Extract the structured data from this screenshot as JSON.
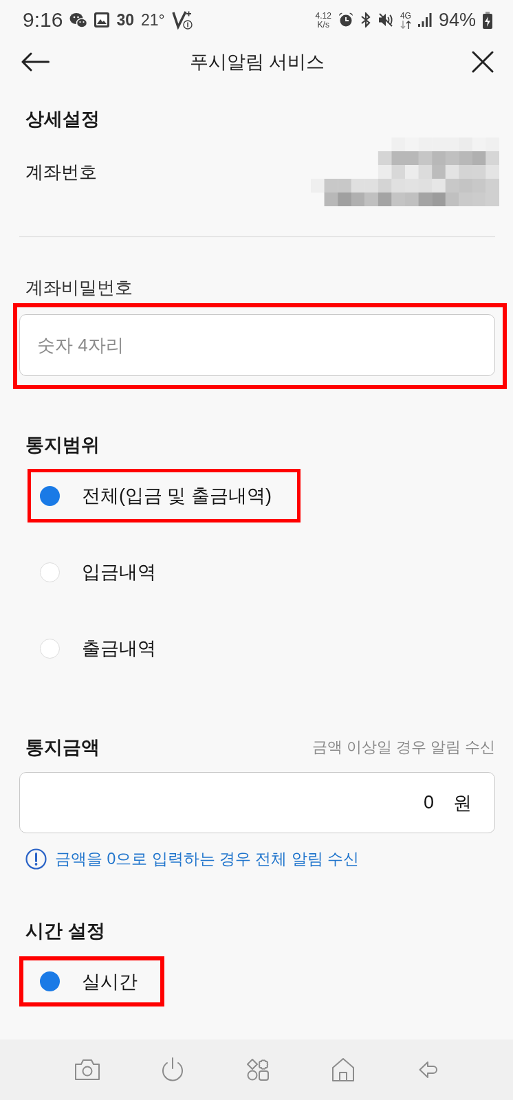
{
  "status_bar": {
    "time": "9:16",
    "notification_count": "30",
    "temperature": "21°",
    "net_speed": {
      "value": "4.12",
      "unit": "K/s"
    },
    "network": "4G",
    "battery": "94%"
  },
  "header": {
    "title": "푸시알림 서비스"
  },
  "detail": {
    "heading": "상세설정",
    "account_label": "계좌번호"
  },
  "password": {
    "label": "계좌비밀번호",
    "placeholder": "숫자 4자리",
    "highlighted": true
  },
  "notify_scope": {
    "heading": "통지범위",
    "options": [
      {
        "label": "전체(입금 및 출금내역)",
        "selected": true,
        "highlighted": true
      },
      {
        "label": "입금내역",
        "selected": false,
        "highlighted": false
      },
      {
        "label": "출금내역",
        "selected": false,
        "highlighted": false
      }
    ]
  },
  "notify_amount": {
    "heading": "통지금액",
    "hint": "금액 이상일 경우 알림 수신",
    "value": "0",
    "unit": "원",
    "info": "금액을 0으로 입력하는 경우 전체 알림 수신"
  },
  "time_setting": {
    "heading": "시간 설정",
    "options": [
      {
        "label": "실시간",
        "selected": true,
        "highlighted": true
      }
    ]
  }
}
